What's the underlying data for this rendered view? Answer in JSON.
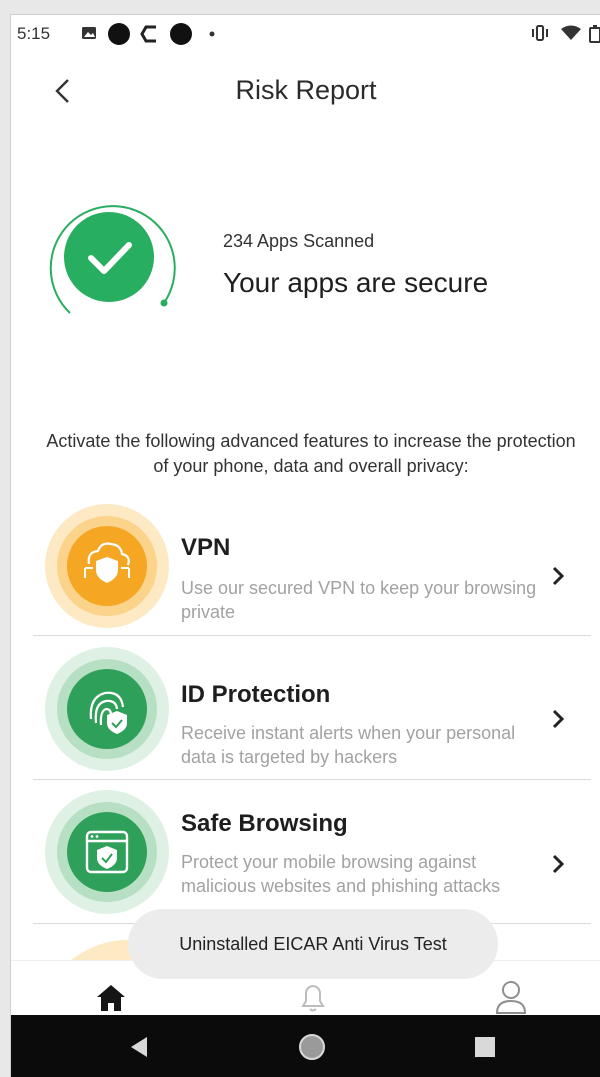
{
  "status_bar": {
    "time": "5:15",
    "left_icons": [
      "image-icon",
      "circle-icon",
      "c-app-icon",
      "circle-icon",
      "dot-icon"
    ],
    "right_icons": [
      "vibrate-icon",
      "wifi-icon",
      "battery-icon"
    ]
  },
  "header": {
    "title": "Risk Report",
    "back_icon": "chevron-left-icon"
  },
  "summary": {
    "apps_scanned": "234 Apps Scanned",
    "status_title": "Your apps are secure",
    "status_icon": "check-icon",
    "accent_color": "#27ae60"
  },
  "intro": "Activate the following advanced features to increase the protection of your phone, data and overall privacy:",
  "features": [
    {
      "name": "VPN",
      "description": "Use our secured VPN to keep your browsing private",
      "icon": "cloud-shield-icon",
      "color": "#f5a623"
    },
    {
      "name": "ID Protection",
      "description": "Receive instant alerts when your personal data is targeted by hackers",
      "icon": "fingerprint-shield-icon",
      "color": "#2fa05a"
    },
    {
      "name": "Safe Browsing",
      "description": "Protect your mobile browsing against malicious websites and phishing attacks",
      "icon": "browser-shield-icon",
      "color": "#2fa05a"
    }
  ],
  "toast": "Uninstalled EICAR Anti Virus Test",
  "bottom_nav": [
    "home-icon",
    "bell-icon",
    "profile-icon"
  ],
  "system_nav": [
    "back-triangle-icon",
    "home-circle-icon",
    "recents-square-icon"
  ]
}
